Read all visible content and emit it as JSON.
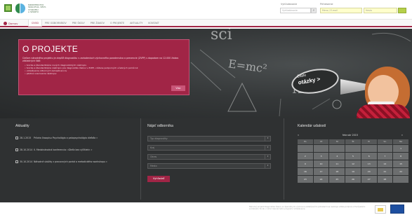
{
  "header": {
    "logo_text": [
      "MINISTERSTVO",
      "ŠKOLSTVA, VEDY,",
      "VÝSKUMU",
      "A ŠPORTU"
    ],
    "search_label": "Vyhľadávanie",
    "search_placeholder": "Vyhľadávanie",
    "search_icon": "search-icon",
    "login_label": "Prihlásenie",
    "login_user_placeholder": "Meno / E-mail",
    "login_pass_placeholder": "Heslo"
  },
  "nav": {
    "home_label": "Domov",
    "items": [
      {
        "label": "Úvod",
        "active": true
      },
      {
        "label": "Pre odborníkov",
        "active": false
      },
      {
        "label": "Pre školy",
        "active": false
      },
      {
        "label": "Pre žiakov",
        "active": false
      },
      {
        "label": "O projekte",
        "active": false
      },
      {
        "label": "Aktuality",
        "active": false
      },
      {
        "label": "Kontakt",
        "active": false
      }
    ]
  },
  "hero": {
    "title": "O PROJEKTE",
    "intro": "Cieľom národného projektu je zlepšiť diagnostiku v zariadeniach výchovného poradenstva a prevencie (ZVPP) s dopadom na 12.000 žiakov základných škôl:",
    "bullets": [
      "tvorba a štandardizácia nových diagnostických nástrojov",
      "tvorba a štandardizácia nástrojov pre diagnostiku žiakov v ZVPP, vrátane podporných učebných pomôcok",
      "vzdelávanie odborných zamestnancov",
      "pilotné overovanie nástrojov"
    ],
    "more_label": "Viac",
    "bubble_line1": "Časte",
    "bubble_line2": "otázky >",
    "chalk_sci": "sci",
    "chalk_formula": "E=mc²",
    "chalk_nums": "123"
  },
  "news": {
    "title": "Aktuality",
    "items": [
      {
        "date": "28.1.2015",
        "text": "Príloha časopisu Psychológia a patopsychológia dieťaťa »"
      },
      {
        "date": "28.10.2014",
        "text": "II. Medzinárodná konferencia: »Dieťa bez výčitiek« »"
      },
      {
        "date": "30.10.2014",
        "text": "Náhodné ukážky z pracovných porád a metodického workshopu »"
      }
    ]
  },
  "finder": {
    "title": "Nájsť odborníka",
    "selects": [
      "Typ diagnostiky",
      "Kraj",
      "Okres",
      "Mesto"
    ],
    "button_label": "Vyhľadať"
  },
  "calendar": {
    "title": "Kalendár udalostí",
    "month": "február 2015",
    "prev": "«",
    "next": "»",
    "weekdays": [
      "Po",
      "Ut",
      "St",
      "Št",
      "Pi",
      "So",
      "Ne"
    ],
    "days": [
      "",
      "",
      "",
      "",
      "",
      "",
      "1",
      "2",
      "3",
      "4",
      "5",
      "6",
      "7",
      "8",
      "9",
      "10",
      "11",
      "12",
      "13",
      "14",
      "15",
      "16",
      "17",
      "18",
      "19",
      "20",
      "21",
      "22",
      "23",
      "24",
      "25",
      "26",
      "27",
      "28",
      ""
    ]
  },
  "footer": {
    "text": "Národný projekt Diagnostika žiakov so špeciálnymi výchovno-vzdelávacími potrebami sa realizuje vďaka podpore z Európskeho sociálneho fondu v rámci Operačného programu Vzdelávanie."
  }
}
